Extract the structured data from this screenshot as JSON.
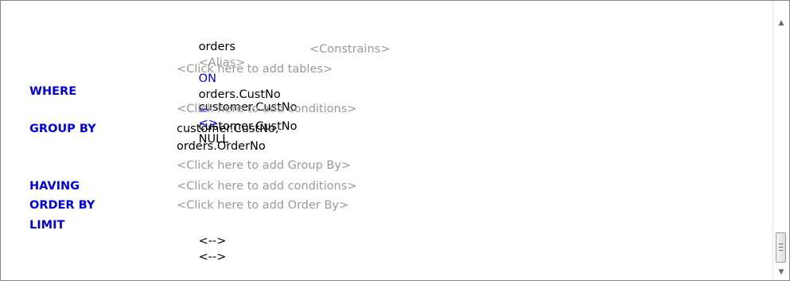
{
  "lines": {
    "join": {
      "table": "orders",
      "alias": "<Alias>",
      "on_kw": "ON",
      "left": "orders.CustNo",
      "op": "=",
      "right": "customer.CustNo"
    },
    "constrains_hint": "<Constrains>",
    "add_tables_hint": "<Click here to add tables>",
    "where": {
      "keyword": "WHERE",
      "left": "customer.CustNo",
      "op": "<>",
      "right": "NULL",
      "add_hint": "<Click here to add conditions>"
    },
    "group_by": {
      "keyword": "GROUP BY",
      "items": [
        "customer.CustNo,",
        "orders.OrderNo"
      ],
      "add_hint": "<Click here to add Group By>"
    },
    "having": {
      "keyword": "HAVING",
      "add_hint": "<Click here to add conditions>"
    },
    "order_by": {
      "keyword": "ORDER BY",
      "add_hint": "<Click here to add Order By>"
    },
    "limit": {
      "keyword": "LIMIT",
      "value1": "<-->",
      "value2": "<-->"
    }
  },
  "scrollbar": {
    "up_icon": "arrow-up-icon",
    "down_icon": "arrow-down-icon",
    "scroll_position": 0.92
  },
  "colors": {
    "keyword": "#0000ee",
    "operator": "#0000ff",
    "hint": "#9a9a9a",
    "text": "#000000"
  }
}
